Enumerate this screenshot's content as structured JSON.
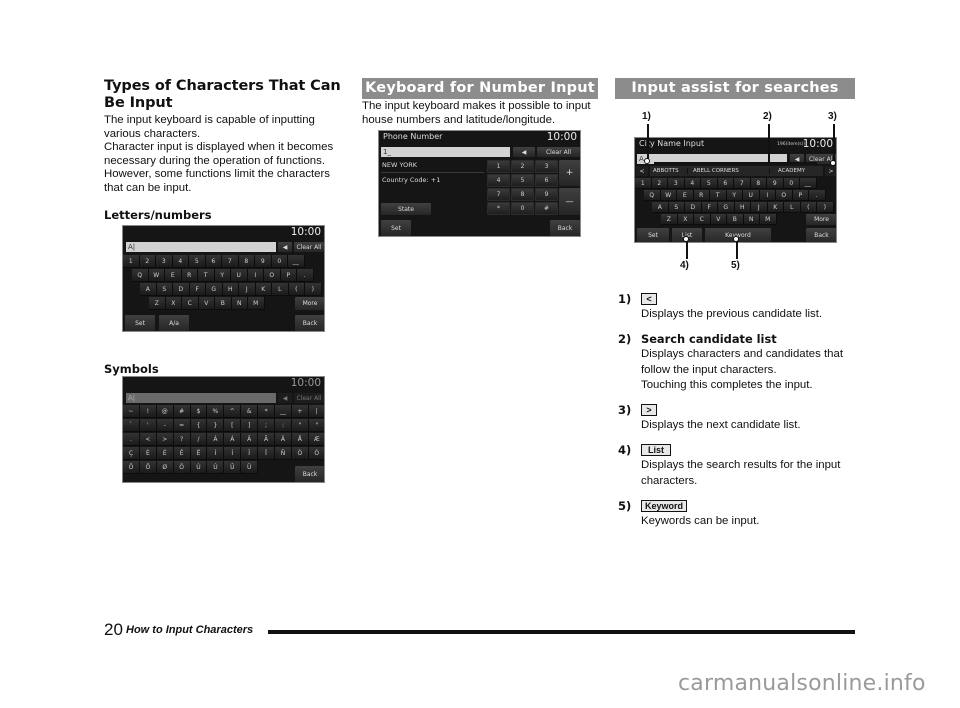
{
  "col1": {
    "heading": "Types of Characters That Can Be Input",
    "intro": [
      "The input keyboard is capable of inputting various characters.",
      "Character input is displayed when it becomes necessary during the operation of functions. However, some functions limit the characters that can be input."
    ],
    "letters_heading": "Letters/numbers",
    "symbols_heading": "Symbols",
    "letters_screen": {
      "clock": "10:00",
      "input_value": "A|",
      "backspace_icon": "◀",
      "clear_all": "Clear All",
      "rows": [
        [
          "1",
          "2",
          "3",
          "4",
          "5",
          "6",
          "7",
          "8",
          "9",
          "0",
          "__"
        ],
        [
          "Q",
          "W",
          "E",
          "R",
          "T",
          "Y",
          "U",
          "I",
          "O",
          "P",
          "."
        ],
        [
          "A",
          "S",
          "D",
          "F",
          "G",
          "H",
          "J",
          "K",
          "L",
          "(",
          ")"
        ],
        [
          "Z",
          "X",
          "C",
          "V",
          "B",
          "N",
          "M"
        ]
      ],
      "more": "More",
      "set": "Set",
      "case": "A/a",
      "back": "Back"
    },
    "symbols_screen": {
      "clock": "10:00",
      "input_value": "A|",
      "backspace_icon": "◀",
      "clear_all": "Clear All",
      "rows": [
        [
          "~",
          "!",
          "@",
          "#",
          "$",
          "%",
          "^",
          "&",
          "*",
          "__",
          "+",
          "|"
        ],
        [
          "`",
          "'",
          "-",
          "=",
          "{",
          "}",
          "[",
          "]",
          ";",
          ":",
          "\"",
          "\""
        ],
        [
          ".",
          "<",
          ">",
          "?",
          "/",
          "À",
          "Á",
          "Â",
          "Ã",
          "Ä",
          "Å",
          "Æ"
        ],
        [
          "Ç",
          "È",
          "É",
          "Ê",
          "Ë",
          "Ì",
          "Í",
          "Î",
          "Ï",
          "Ñ",
          "Ò",
          "Ó"
        ],
        [
          "Ô",
          "Õ",
          "Ø",
          "Ö",
          "Ù",
          "Ú",
          "Û",
          "Ü"
        ]
      ],
      "back": "Back"
    }
  },
  "col2": {
    "heading": "Keyboard for Number Input",
    "intro": "The input keyboard makes it possible to input house numbers and latitude/longitude.",
    "screen": {
      "title": "Phone Number",
      "clock": "10:00",
      "input_value": "1_",
      "backspace_icon": "◀",
      "clear_all": "Clear All",
      "info_lines": [
        "NEW YORK",
        "Country Code: +1"
      ],
      "state": "State",
      "keys": [
        [
          "1",
          "2",
          "3"
        ],
        [
          "4",
          "5",
          "6"
        ],
        [
          "7",
          "8",
          "9"
        ],
        [
          "*",
          "0",
          "#"
        ]
      ],
      "plus": "+",
      "minus": "—",
      "set": "Set",
      "back": "Back"
    }
  },
  "col3": {
    "heading": "Input assist for searches",
    "callouts_top": [
      "1)",
      "2)",
      "3)"
    ],
    "callouts_bottom": [
      "4)",
      "5)"
    ],
    "screen": {
      "title": "City Name Input",
      "count": "196(item(s))",
      "clock": "10:00",
      "input_value": "A",
      "backspace_icon": "◀",
      "clear_all": "Clear All",
      "prev_icon": "<",
      "next_icon": ">",
      "candidates": [
        "ABBOTTS",
        "ABELL CORNERS",
        "ACADEMY"
      ],
      "rows": [
        [
          "1",
          "2",
          "3",
          "4",
          "5",
          "6",
          "7",
          "8",
          "9",
          "0",
          "__"
        ],
        [
          "Q",
          "W",
          "E",
          "R",
          "T",
          "Y",
          "U",
          "I",
          "O",
          "P",
          "."
        ],
        [
          "A",
          "S",
          "D",
          "F",
          "G",
          "H",
          "J",
          "K",
          "L",
          "(",
          ")"
        ],
        [
          "Z",
          "X",
          "C",
          "V",
          "B",
          "N",
          "M"
        ]
      ],
      "more": "More",
      "set": "Set",
      "list": "List",
      "keyword": "Keyword",
      "back": "Back"
    },
    "items": [
      {
        "num": "1)",
        "glyph": "<",
        "title": "",
        "desc": [
          "Displays the previous candidate list."
        ]
      },
      {
        "num": "2)",
        "glyph": "",
        "title": "Search candidate list",
        "desc": [
          "Displays characters and candidates that follow the input characters.",
          "Touching this completes the input."
        ]
      },
      {
        "num": "3)",
        "glyph": ">",
        "title": "",
        "desc": [
          "Displays the next candidate list."
        ]
      },
      {
        "num": "4)",
        "glyph": "List",
        "title": "",
        "desc": [
          "Displays the search results for the input characters."
        ]
      },
      {
        "num": "5)",
        "glyph": "Keyword",
        "title": "",
        "desc": [
          "Keywords can be input."
        ]
      }
    ]
  },
  "footer": {
    "page_number": "20",
    "section_title": "How to Input Characters"
  },
  "watermark": "carmanualsonline.info"
}
